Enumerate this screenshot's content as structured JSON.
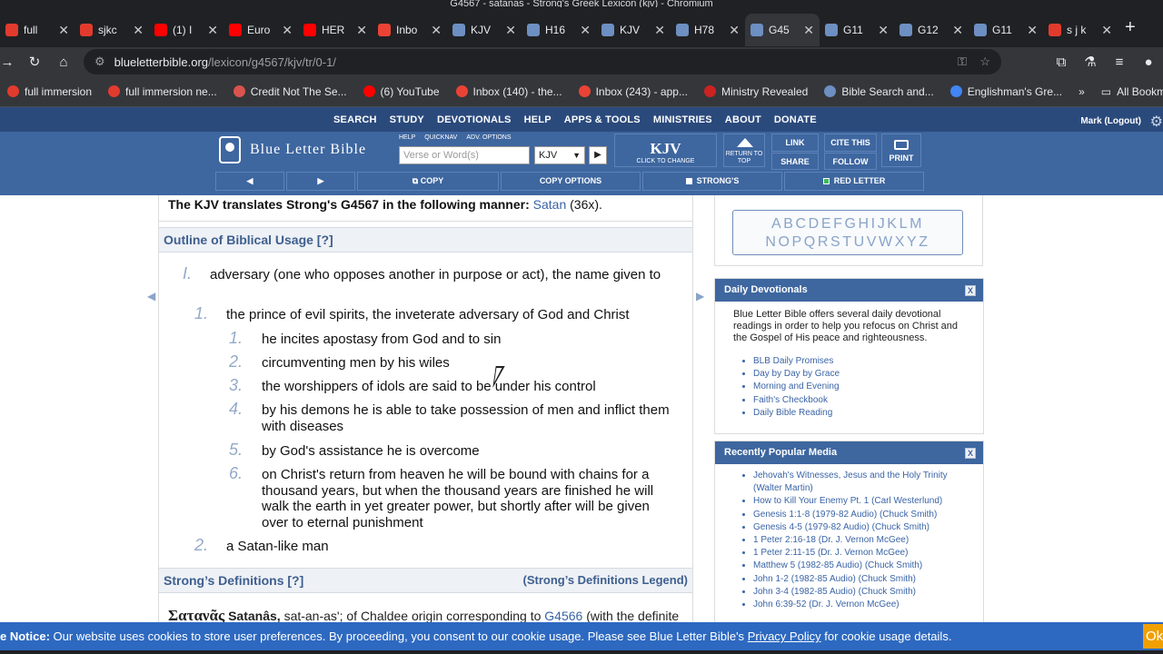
{
  "window": {
    "title": "G4567 - satanas - Strong's Greek Lexicon (kjv) - Chromium"
  },
  "tabs": [
    {
      "label": "full",
      "color": "#e23b2e",
      "active": false
    },
    {
      "label": "sjkc",
      "color": "#e23b2e",
      "active": false
    },
    {
      "label": "(1) I",
      "color": "#ff0000",
      "active": false
    },
    {
      "label": "Euro",
      "color": "#ff0000",
      "active": false
    },
    {
      "label": "HER",
      "color": "#ff0000",
      "active": false
    },
    {
      "label": "Inbo",
      "color": "#ea4335",
      "active": false
    },
    {
      "label": "KJV",
      "color": "#6d8fc2",
      "active": false
    },
    {
      "label": "H16",
      "color": "#6d8fc2",
      "active": false
    },
    {
      "label": "KJV",
      "color": "#6d8fc2",
      "active": false
    },
    {
      "label": "H78",
      "color": "#6d8fc2",
      "active": false
    },
    {
      "label": "G45",
      "color": "#6d8fc2",
      "active": true
    },
    {
      "label": "G11",
      "color": "#6d8fc2",
      "active": false
    },
    {
      "label": "G12",
      "color": "#6d8fc2",
      "active": false
    },
    {
      "label": "G11",
      "color": "#6d8fc2",
      "active": false
    },
    {
      "label": "s j k",
      "color": "#e23b2e",
      "active": false
    }
  ],
  "address": {
    "host": "blueletterbible.org",
    "path": "/lexicon/g4567/kjv/tr/0-1/"
  },
  "bookmarks": [
    {
      "label": "full immersion",
      "color": "#e23b2e"
    },
    {
      "label": "full immersion ne...",
      "color": "#e23b2e"
    },
    {
      "label": "Credit Not The Se...",
      "color": "#d9534f"
    },
    {
      "label": "(6) YouTube",
      "color": "#ff0000"
    },
    {
      "label": "Inbox (140) - the...",
      "color": "#ea4335"
    },
    {
      "label": "Inbox (243) - app...",
      "color": "#ea4335"
    },
    {
      "label": "Ministry Revealed",
      "color": "#cc2222"
    },
    {
      "label": "Bible Search and...",
      "color": "#6d8fc2"
    },
    {
      "label": "Englishman's Gre...",
      "color": "#4285f4"
    }
  ],
  "bookmarks_more": "»",
  "bookmarks_all": "All Bookmarks",
  "sitenav": {
    "items": [
      "SEARCH",
      "STUDY",
      "DEVOTIONALS",
      "HELP",
      "APPS & TOOLS",
      "MINISTRIES",
      "ABOUT",
      "DONATE"
    ],
    "user": "Mark (Logout)"
  },
  "header": {
    "logo": "Blue Letter Bible",
    "search_links": [
      "HELP",
      "QUICKNAV",
      "ADV. OPTIONS"
    ],
    "search_placeholder": "Verse or Word(s)",
    "version": "KJV",
    "kjv_big": "KJV",
    "kjv_small": "CLICK TO CHANGE",
    "return_label": "RETURN TO TOP",
    "link": "LINK",
    "cite": "CITE THIS",
    "share": "SHARE",
    "follow": "FOLLOW",
    "print": "PRINT",
    "sub": {
      "prev": "◀",
      "next": "▶",
      "copy": "COPY",
      "copy_options": "COPY OPTIONS",
      "strongs": "STRONG'S",
      "red_letter": "RED LETTER"
    }
  },
  "kjv_translation": {
    "prefix": "The KJV translates Strong's G4567 in the following manner:",
    "word": "Satan",
    "count": "(36x)."
  },
  "outline": {
    "heading": "Outline of Biblical Usage [?]",
    "items": [
      {
        "num": "I.",
        "text": "adversary (one who opposes another in purpose or act), the name given to"
      },
      {
        "num": "1.",
        "text": "the prince of evil spirits, the inveterate adversary of God and Christ"
      },
      {
        "num": "1.",
        "text": "he incites apostasy from God and to sin"
      },
      {
        "num": "2.",
        "text": "circumventing men by his wiles"
      },
      {
        "num": "3.",
        "text": "the worshippers of idols are said to be under his control"
      },
      {
        "num": "4.",
        "text": "by his demons he is able to take possession of men and inflict them with diseases"
      },
      {
        "num": "5.",
        "text": "by God's assistance he is overcome"
      },
      {
        "num": "6.",
        "text": "on Christ's return from heaven he will be bound with chains for a thousand years, but when the thousand years are finished he will walk the earth in yet greater power, but shortly after will be given over to eternal punishment"
      },
      {
        "num": "2.",
        "text": "a Satan-like man"
      }
    ]
  },
  "definitions": {
    "heading": "Strong’s Definitions [?]",
    "legend": "(Strong’s Definitions Legend)",
    "greek": "Σατανᾶς",
    "translit": "Satanâs,",
    "pron": "sat-an-as'; of Chaldee origin corresponding to",
    "ref": "G4566",
    "rest": "(with the definite"
  },
  "alphabet": {
    "row1": "ABCDEFGHIJKLM",
    "row2": "NOPQRSTUVWXYZ"
  },
  "daily_devotionals": {
    "title": "Daily Devotionals",
    "close": "X",
    "text": "Blue Letter Bible offers several daily devotional readings in order to help you refocus on Christ and the Gospel of His peace and righteousness.",
    "links": [
      "BLB Daily Promises",
      "Day by Day by Grace",
      "Morning and Evening",
      "Faith's Checkbook",
      "Daily Bible Reading"
    ]
  },
  "popular_media": {
    "title": "Recently Popular Media",
    "close": "X",
    "links": [
      "Jehovah's Witnesses, Jesus and the Holy Trinity (Walter Martin)",
      "How to Kill Your Enemy Pt. 1 (Carl Westerlund)",
      "Genesis 1:1-8 (1979-82 Audio) (Chuck Smith)",
      "Genesis 4-5 (1979-82 Audio) (Chuck Smith)",
      "1 Peter 2:16-18 (Dr. J. Vernon McGee)",
      "1 Peter 2:11-15 (Dr. J. Vernon McGee)",
      "Matthew 5 (1982-85 Audio) (Chuck Smith)",
      "John 1-2 (1982-85 Audio) (Chuck Smith)",
      "John 3-4 (1982-85 Audio) (Chuck Smith)",
      "John 6:39-52 (Dr. J. Vernon McGee)"
    ]
  },
  "cookie": {
    "label": "e Notice:",
    "text": "Our website uses cookies to store user preferences. By proceeding, you consent to our cookie usage. Please see Blue Letter Bible's",
    "link": "Privacy Policy",
    "tail": "for cookie usage details.",
    "ok": "Ok"
  }
}
